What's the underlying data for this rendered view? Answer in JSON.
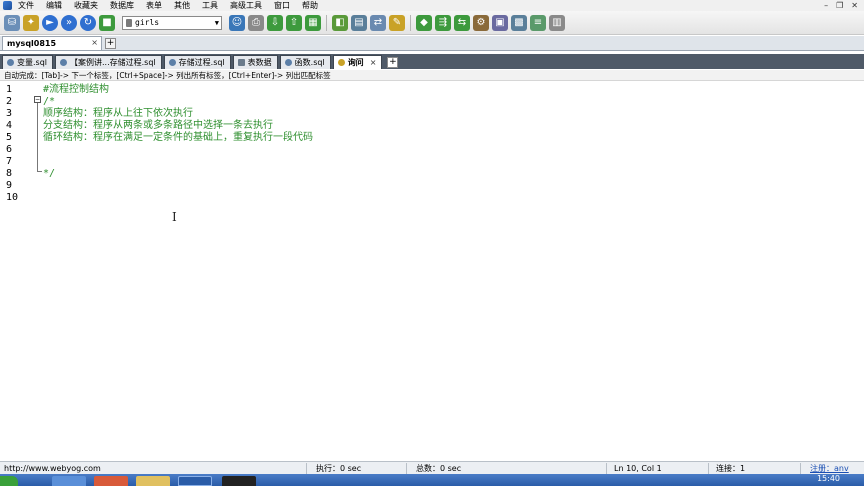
{
  "menu": [
    "文件",
    "编辑",
    "收藏夹",
    "数据库",
    "表单",
    "其他",
    "工具",
    "高级工具",
    "窗口",
    "帮助"
  ],
  "toolbar": {
    "database": "girls"
  },
  "connection_tab": {
    "label": "mysql0815",
    "close": "×"
  },
  "sql_tabs": [
    {
      "label": "变量.sql",
      "active": false
    },
    {
      "label": "【案例讲...存储过程.sql",
      "active": false
    },
    {
      "label": "存储过程.sql",
      "active": false
    },
    {
      "label": "表数据",
      "active": false
    },
    {
      "label": "函数.sql",
      "active": false
    },
    {
      "label": "询问",
      "active": true,
      "close": "×"
    }
  ],
  "add_tab": "+",
  "hint": "自动完成：[Tab]-> 下一个标签，[Ctrl+Space]-> 列出所有标签，[Ctrl+Enter]-> 列出匹配标签",
  "editor": {
    "lines": [
      {
        "num": "1",
        "code": "#流程控制结构"
      },
      {
        "num": "2",
        "code": "/*"
      },
      {
        "num": "3",
        "code": "顺序结构：程序从上往下依次执行"
      },
      {
        "num": "4",
        "code": "分支结构：程序从两条或多条路径中选择一条去执行"
      },
      {
        "num": "5",
        "code": "循环结构：程序在满足一定条件的基础上，重复执行一段代码"
      },
      {
        "num": "6",
        "code": ""
      },
      {
        "num": "7",
        "code": ""
      },
      {
        "num": "8",
        "code": "*/"
      },
      {
        "num": "9",
        "code": ""
      },
      {
        "num": "10",
        "code": ""
      }
    ]
  },
  "status": {
    "url": "http://www.webyog.com",
    "exec": "执行：0 sec",
    "total": "总数：0 sec",
    "position": "Ln 10, Col 1",
    "connections": "连接：1",
    "register": "注册：anv"
  },
  "taskbar": {
    "clock": "15:40"
  }
}
